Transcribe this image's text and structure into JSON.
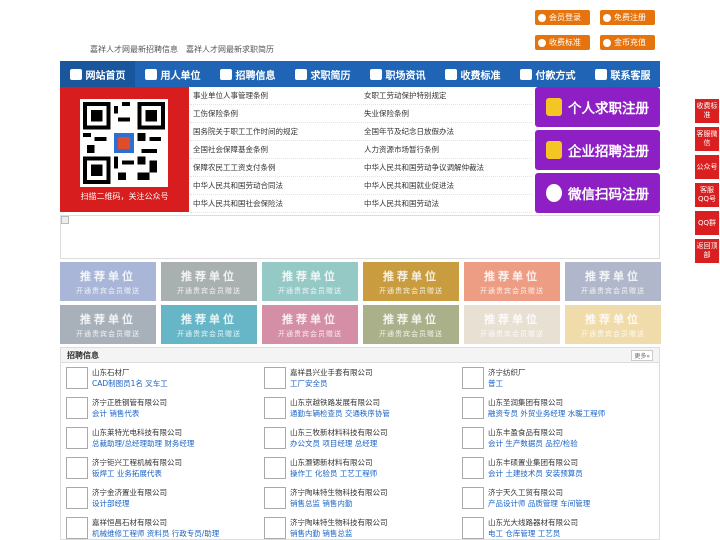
{
  "top_links": [
    "嘉祥人才网最新招聘信息",
    "嘉祥人才网最新求职简历"
  ],
  "top_buttons": [
    "会员登录",
    "免费注册",
    "收费标准",
    "金币充值"
  ],
  "nav": [
    "网站首页",
    "用人单位",
    "招聘信息",
    "求职简历",
    "职场资讯",
    "收费标准",
    "付款方式",
    "联系客服"
  ],
  "qr_caption": "扫描二维码，关注公众号",
  "news": [
    [
      "事业单位人事管理条例",
      "女职工劳动保护特别规定"
    ],
    [
      "工伤保险条例",
      "失业保险条例"
    ],
    [
      "国务院关于职工工作时间的规定",
      "全国年节及纪念日放假办法"
    ],
    [
      "全国社会保障基金条例",
      "人力资源市场暂行条例"
    ],
    [
      "保障农民工工资支付条例",
      "中华人民共和国劳动争议调解仲裁法"
    ],
    [
      "中华人民共和国劳动合同法",
      "中华人民共和国就业促进法"
    ],
    [
      "中华人民共和国社会保险法",
      "中华人民共和国劳动法"
    ]
  ],
  "register": [
    "个人求职注册",
    "企业招聘注册",
    "微信扫码注册"
  ],
  "rec_title": "推荐单位",
  "rec_sub": "开通贵宾会员赠送",
  "rec_colors": [
    "#a9b6d8",
    "#a8b0b0",
    "#95c9c6",
    "#c99c3f",
    "#ed9d83",
    "#b0b7ca",
    "#a8b0ba",
    "#66b6c8",
    "#d48ea6",
    "#aab08a",
    "#e8e0d3",
    "#efdcaa"
  ],
  "jobs_title": "招聘信息",
  "jobs_more": "更多»",
  "companies": [
    {
      "name": "山东石材厂",
      "jobs": "CAD制图员1名 叉车工"
    },
    {
      "name": "嘉祥县兴业手套有限公司",
      "jobs": "工厂安全员"
    },
    {
      "name": "济宁纺织厂",
      "jobs": "普工"
    },
    {
      "name": "济宁正胜钢管有限公司",
      "jobs": "会计 销售代表"
    },
    {
      "name": "山东京越铁路发展有限公司",
      "jobs": "通勤车辆检查员 交通秩序协管"
    },
    {
      "name": "山东圣润集团有限公司",
      "jobs": "融资专员 外贸业务经理 水暖工程师"
    },
    {
      "name": "山东莱特光电科技有限公司",
      "jobs": "总裁助理/总经理助理 财务经理"
    },
    {
      "name": "山东三牧新材料科技有限公司",
      "jobs": "办公文员 项目经理 总经理"
    },
    {
      "name": "山东丰盈食品有限公司",
      "jobs": "会计 生产数据员 品控/检验"
    },
    {
      "name": "济宁钜兴工程机械有限公司",
      "jobs": "钣焊工 业务拓展代表"
    },
    {
      "name": "山东灏锶新材料有限公司",
      "jobs": "操作工 化验员 工艺工程师"
    },
    {
      "name": "山东丰硕置业集团有限公司",
      "jobs": "会计 土建技术员 安装预算员"
    },
    {
      "name": "济宁金济置业有限公司",
      "jobs": "设计部经理"
    },
    {
      "name": "济宁陶味特生物科技有限公司",
      "jobs": "销售总监 销售内勤"
    },
    {
      "name": "济宁天久工贸有限公司",
      "jobs": "产品设计师 品质管理 车间管理"
    },
    {
      "name": "嘉祥恒昌石材有限公司",
      "jobs": "机械维修工程师 资料员 行政专员/助理"
    },
    {
      "name": "济宁陶味特生物科技有限公司",
      "jobs": "销售内勤 销售总监"
    },
    {
      "name": "山东光大线路器材有限公司",
      "jobs": "电工 仓库管理 工艺员"
    }
  ],
  "side": [
    "收费标准",
    "客服微信",
    "公众号",
    "客服QQ号",
    "QQ群",
    "返回顶部"
  ],
  "colors": {
    "nav_bg": "#1f64b5",
    "orange": "#e6740e",
    "purple": "#8e1fc4",
    "red": "#d91f1f",
    "link": "#1a63c4"
  }
}
